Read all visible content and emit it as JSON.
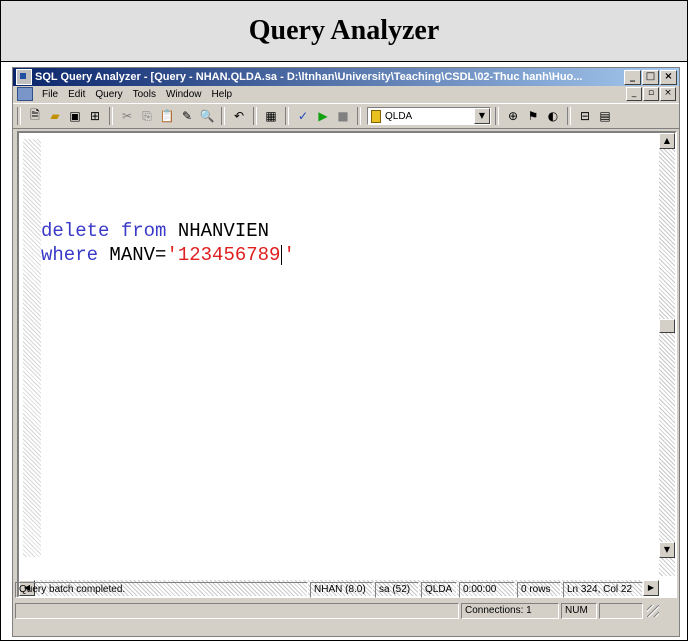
{
  "slide": {
    "title": "Query Analyzer"
  },
  "window": {
    "title": "SQL Query Analyzer - [Query - NHAN.QLDA.sa - D:\\ltnhan\\University\\Teaching\\CSDL\\02-Thuc hanh\\Huo...",
    "controls": {
      "minimize": "_",
      "maximize": "□",
      "close": "×"
    }
  },
  "menu": {
    "items": [
      "File",
      "Edit",
      "Query",
      "Tools",
      "Window",
      "Help"
    ],
    "doc_controls": {
      "minimize": "_",
      "restore": "▫",
      "close": "×"
    }
  },
  "toolbar": {
    "database": "QLDA",
    "icons": [
      "new-query-icon",
      "open-icon",
      "save-icon",
      "insert-template-icon",
      "cut-icon",
      "copy-icon",
      "paste-icon",
      "clear-icon",
      "find-icon",
      "undo-icon",
      "results-mode-icon",
      "parse-icon",
      "execute-icon",
      "stop-icon",
      "object-search-icon",
      "show-plan-icon",
      "client-stats-icon",
      "object-browser-icon",
      "results-pane-icon"
    ]
  },
  "editor": {
    "line1": {
      "kw": "delete from",
      "rest": " NHANVIEN"
    },
    "line2": {
      "kw": "where",
      "mid": " MANV=",
      "q1": "'",
      "str": "123456789",
      "q2": "'"
    }
  },
  "status": {
    "message": "Query batch completed.",
    "server": "NHAN (8.0)",
    "user": "sa (52)",
    "db": "QLDA",
    "time": "0:00:00",
    "rows": "0 rows",
    "position": "Ln 324, Col 22",
    "connections": "Connections: 1",
    "num": "NUM"
  },
  "colors": {
    "keyword": "#3a3ac8",
    "string": "#e02020",
    "titlebar_start": "#0a246a"
  }
}
